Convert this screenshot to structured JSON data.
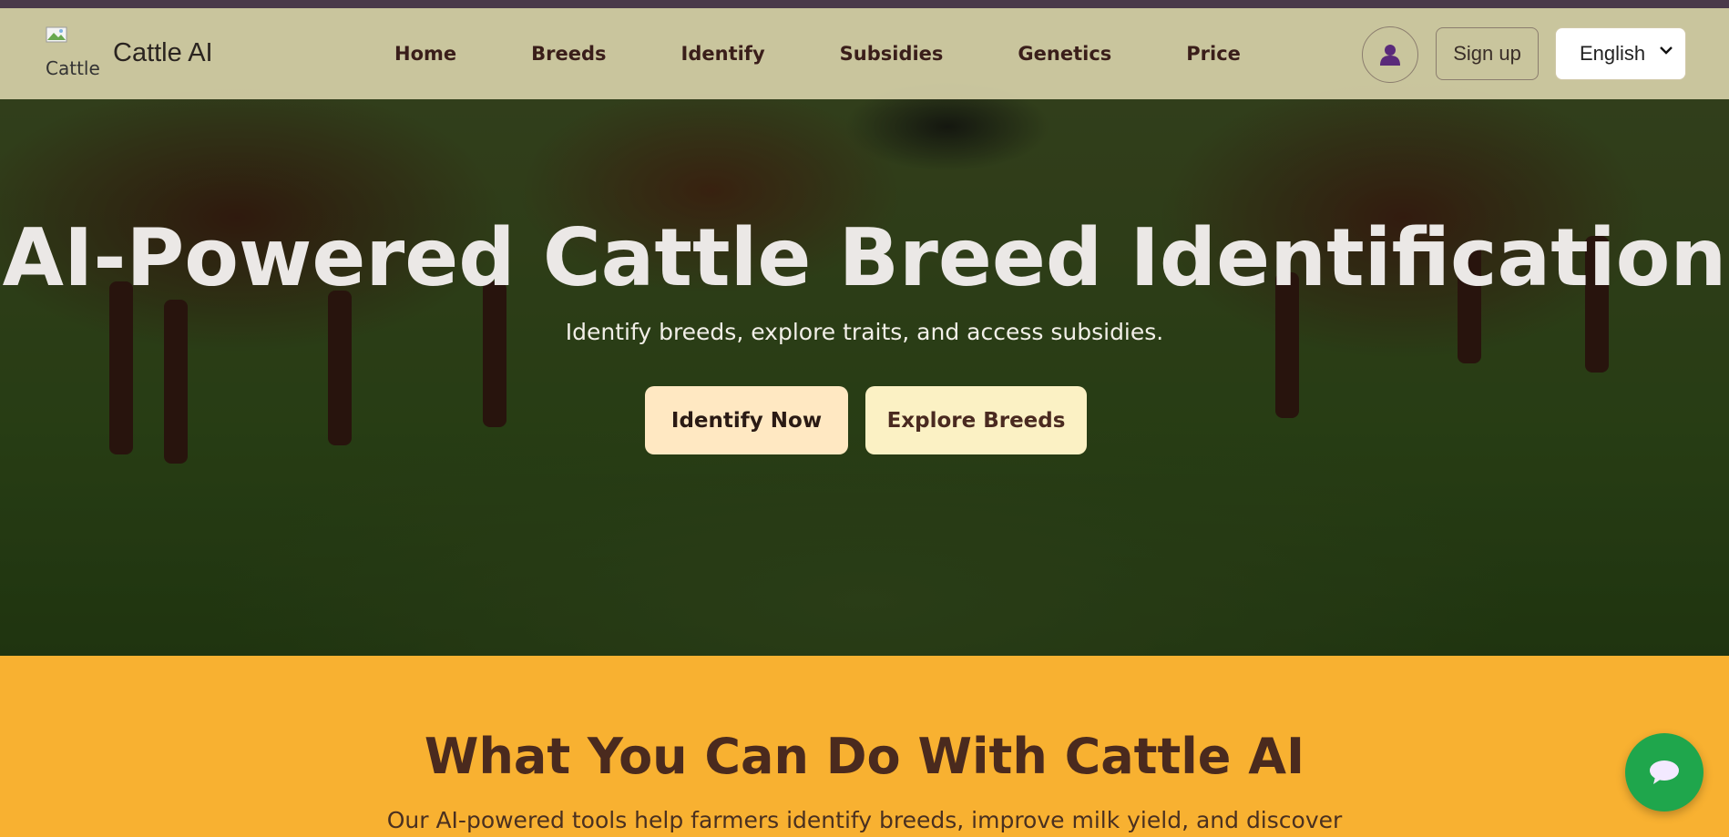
{
  "navbar": {
    "logo_alt": "Cattle",
    "brand": "Cattle AI",
    "links": [
      "Home",
      "Breeds",
      "Identify",
      "Subsidies",
      "Genetics",
      "Price"
    ],
    "signup_label": "Sign up",
    "language": "English"
  },
  "hero": {
    "title": "AI-Powered Cattle Breed Identification",
    "subtitle": "Identify breeds, explore traits, and access subsidies.",
    "primary_button": "Identify Now",
    "secondary_button": "Explore Breeds"
  },
  "features": {
    "title": "What You Can Do With Cattle AI",
    "description": "Our AI-powered tools help farmers identify breeds, improve milk yield, and discover"
  },
  "icons": {
    "profile": "user-icon",
    "language_dropdown": "chevron-down-icon",
    "chat": "chat-bubble-icon"
  },
  "colors": {
    "top_strip": "#4a3a4a",
    "navbar": "#d6d0a8",
    "profile_icon": "#5a2a7a",
    "identify_button": "#ffe8c2",
    "explore_button": "#fbf1c4",
    "features_bg": "#f8b131",
    "features_title": "#4a2a1e",
    "chat_fab": "#1fa64c"
  }
}
